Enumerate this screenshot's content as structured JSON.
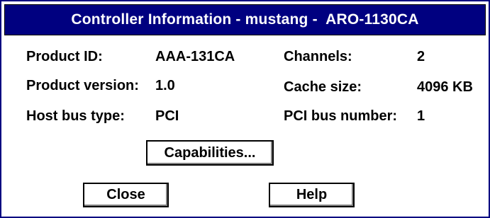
{
  "window": {
    "title": "Controller Information - mustang -  ARO-1130CA"
  },
  "info": {
    "product_id_label": "Product ID:",
    "product_id_value": "AAA-131CA",
    "product_version_label": "Product version:",
    "product_version_value": "1.0",
    "host_bus_type_label": "Host bus type:",
    "host_bus_type_value": "PCI",
    "channels_label": "Channels:",
    "channels_value": "2",
    "cache_size_label": "Cache size:",
    "cache_size_value": "4096 KB",
    "pci_bus_number_label": "PCI bus number:",
    "pci_bus_number_value": "1"
  },
  "buttons": {
    "capabilities": "Capabilities...",
    "close": "Close",
    "help": "Help"
  },
  "colors": {
    "title_bar": "#000080",
    "title_text": "#ffffff",
    "window_background": "#ffffff"
  }
}
